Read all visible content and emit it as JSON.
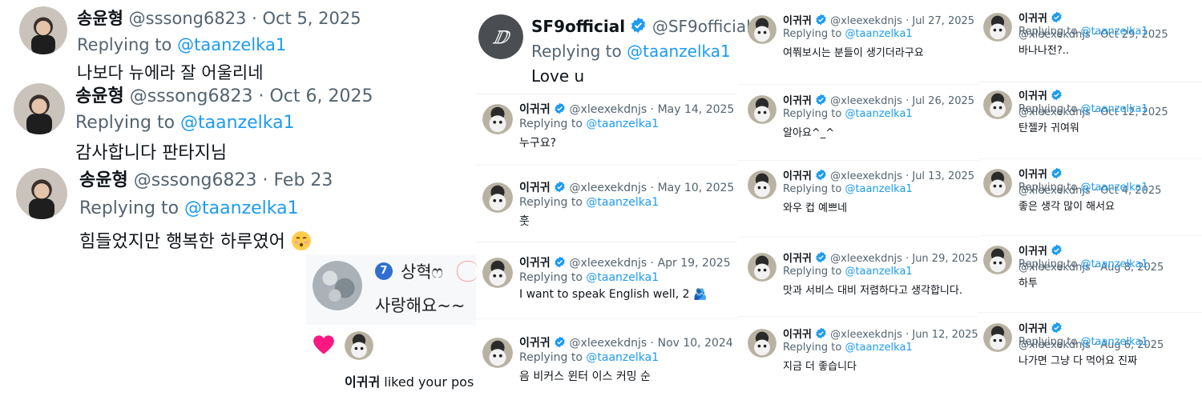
{
  "reply_prefix": "Replying to",
  "left_tweets": [
    {
      "name": "송윤형",
      "handle": "@sssong6823",
      "date": "Oct 5, 2025",
      "reply_to": "@taanzelka1",
      "text": "나보다 뉴에라 잘 어울리네"
    },
    {
      "name": "송윤형",
      "handle": "@sssong6823",
      "date": "Oct 6, 2025",
      "reply_to": "@taanzelka1",
      "text": "감사합니다 판타지님"
    },
    {
      "name": "송윤형",
      "handle": "@sssong6823",
      "date": "Feb 23",
      "reply_to": "@taanzelka1",
      "text": "힘들었지만 행복한 하루였어"
    }
  ],
  "comment_card": {
    "badge": "7",
    "name": "상혁ෆ",
    "text": "사랑해요~~"
  },
  "notification": {
    "name": "이귀귀",
    "text": "liked your pos"
  },
  "sf9": {
    "name": "SF9official",
    "handle": "@SF9official",
    "reply_to": "@taanzelka1",
    "text": "Love u"
  },
  "col2": [
    {
      "name": "이귀귀",
      "handle": "@xleexekdnjs",
      "date": "May 14, 2025",
      "reply_to": "@taanzelka1",
      "text": "누구요?"
    },
    {
      "name": "이귀귀",
      "handle": "@xleexekdnjs",
      "date": "May 10, 2025",
      "reply_to": "@taanzelka1",
      "text": "훗"
    },
    {
      "name": "이귀귀",
      "handle": "@xleexekdnjs",
      "date": "Apr 19, 2025",
      "reply_to": "@taanzelka1",
      "text": "I want to speak English well, 2 🫂"
    },
    {
      "name": "이귀귀",
      "handle": "@xleexekdnjs",
      "date": "Nov 10, 2024",
      "reply_to": "@taanzelka1",
      "text": "음 비커스 윈터 이스 커밍 순"
    }
  ],
  "col3": [
    {
      "name": "이귀귀",
      "handle": "@xleexekdnjs",
      "date": "Jul 27, 2025",
      "reply_to": "@taanzelka1",
      "text": "여쭤보시는 분들이 생기더라구요"
    },
    {
      "name": "이귀귀",
      "handle": "@xleexekdnjs",
      "date": "Jul 26, 2025",
      "reply_to": "@taanzelka1",
      "text": "알아요^_^"
    },
    {
      "name": "이귀귀",
      "handle": "@xleexekdnjs",
      "date": "Jul 13, 2025",
      "reply_to": "@taanzelka1",
      "text": "와우 컵 예쁘네"
    },
    {
      "name": "이귀귀",
      "handle": "@xleexekdnjs",
      "date": "Jun 29, 2025",
      "reply_to": "@taanzelka1",
      "text": "맛과 서비스 대비 저렴하다고 생각합니다."
    },
    {
      "name": "이귀귀",
      "handle": "@xleexekdnjs",
      "date": "Jun 12, 2025",
      "reply_to": "@taanzelka1",
      "text": "지금 더 좋습니다"
    }
  ],
  "col4": [
    {
      "name": "이귀귀",
      "handle": "@xleexekdnjs",
      "date": "Oct 29, 2025",
      "reply_to": "@taanzelka1",
      "text": "바나나전?.."
    },
    {
      "name": "이귀귀",
      "handle": "@xleexekdnjs",
      "date": "Oct 12, 2025",
      "reply_to": "@taanzelka1",
      "text": "탄젤카 귀여워"
    },
    {
      "name": "이귀귀",
      "handle": "@xleexekdnjs",
      "date": "Oct 4, 2025",
      "reply_to": "@taanzelka1",
      "text": "좋은 생각 많이 해서요"
    },
    {
      "name": "이귀귀",
      "handle": "@xleexekdnjs",
      "date": "Aug 8, 2025",
      "reply_to": "@taanzelka1",
      "text": "하투"
    },
    {
      "name": "이귀귀",
      "handle": "@xleexekdnjs",
      "date": "Aug 6, 2025",
      "reply_to": "@taanzelka1",
      "text": "나가면 그냥 다 먹어요 진짜"
    }
  ],
  "colors": {
    "accent": "#1d9bf0",
    "muted": "#536471",
    "text": "#0f1419",
    "heart": "#f91880"
  }
}
